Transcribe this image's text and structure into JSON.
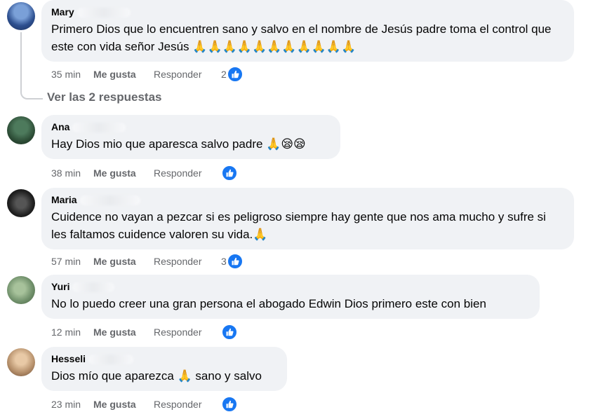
{
  "view_replies": "Ver las 2 respuestas",
  "actions": {
    "like": "Me gusta",
    "reply": "Responder"
  },
  "comments": [
    {
      "author": "Mary",
      "text": "Primero Dios que lo encuentren sano y salvo en el nombre de Jesús padre toma el control que este con vida señor Jesús 🙏🙏🙏🙏🙏🙏🙏🙏🙏🙏🙏",
      "time": "35 min",
      "reaction_count": "2",
      "avatar_icon": "user-avatar-icon"
    },
    {
      "author": "Ana",
      "text": "Hay Dios mio que aparesca salvo padre 🙏😪😪",
      "time": "38 min",
      "reaction_count": "",
      "avatar_icon": "user-avatar-icon"
    },
    {
      "author": "Maria",
      "text": "Cuidence no vayan a pezcar si es peligroso siempre hay gente que nos ama mucho y sufre si les faltamos cuidence valoren su vida.🙏",
      "time": "57 min",
      "reaction_count": "3",
      "avatar_icon": "user-avatar-icon"
    },
    {
      "author": "Yuri",
      "text": "No lo puedo creer una gran persona el abogado Edwin Dios primero este con bien",
      "time": "12 min",
      "reaction_count": "",
      "avatar_icon": "user-avatar-icon"
    },
    {
      "author": "Hesseli",
      "text": "Dios mío que aparezca 🙏 sano y salvo",
      "time": "23 min",
      "reaction_count": "",
      "avatar_icon": "user-avatar-icon"
    }
  ],
  "colors": {
    "bubble": "#f0f2f5",
    "meta": "#65676b",
    "like_blue": "#1877f2"
  }
}
